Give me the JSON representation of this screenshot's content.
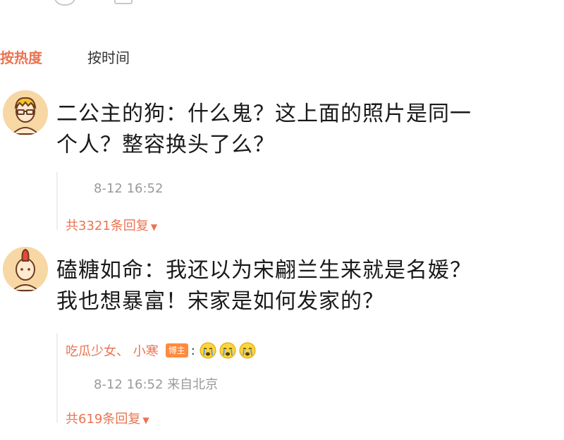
{
  "sort_tabs": {
    "hot": "按热度",
    "time": "按时间"
  },
  "comments": [
    {
      "author": "二公主的狗",
      "text_line1": "二公主的狗：什么鬼？这上面的照片是同一",
      "text_line2": "个人？整容换头了么？",
      "time": "8-12 16:52",
      "reply_count": "共3321条回复"
    },
    {
      "author": "磕糖如命",
      "text_line1": "磕糖如命：我还以为宋翩兰生来就是名媛？",
      "text_line2": "我也想暴富！宋家是如何发家的？",
      "sub_reply": {
        "user": "吃瓜少女、 小寒",
        "badge": "博主",
        "colon": ":"
      },
      "time_location": "8-12 16:52 来自北京",
      "reply_count": "共619条回复"
    }
  ],
  "icons": {
    "dropdown": "caret-down-icon",
    "emoji": "crying-face-icon"
  },
  "colors": {
    "accent": "#eb7350",
    "muted": "#9a9a9a",
    "badge": "#ff8a3d"
  }
}
